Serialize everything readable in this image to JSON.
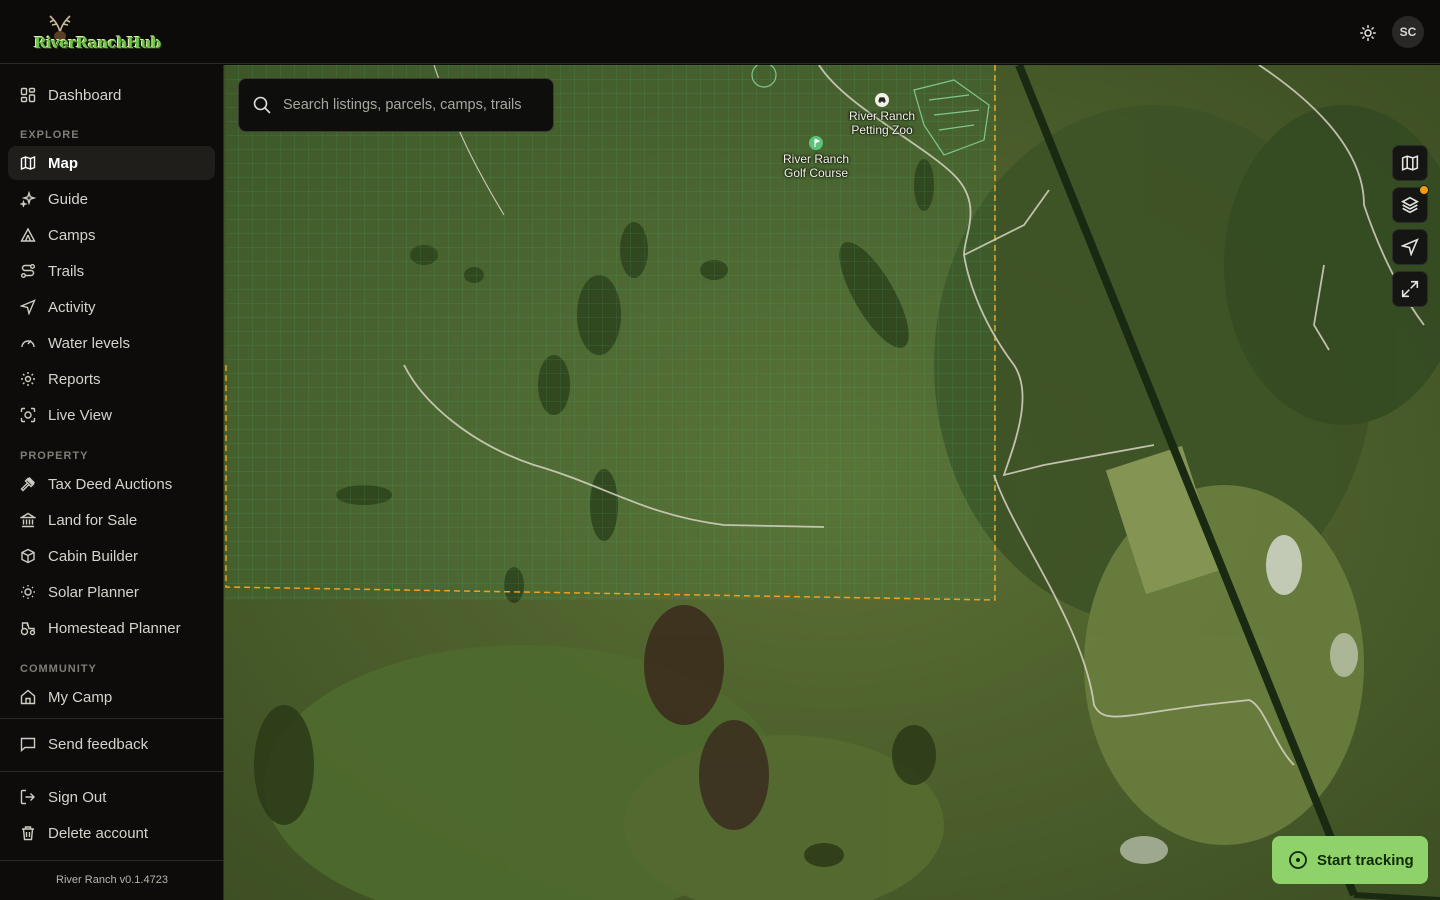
{
  "app": {
    "logo_text": "RiverRanchHub",
    "user_initials": "SC",
    "version": "River Ranch v0.1.4723"
  },
  "search": {
    "placeholder": "Search listings, parcels, camps, trails"
  },
  "sidebar": {
    "dashboard": "Dashboard",
    "explore_label": "EXPLORE",
    "explore": [
      {
        "label": "Map",
        "icon": "map-icon",
        "active": true
      },
      {
        "label": "Guide",
        "icon": "sparkles-icon"
      },
      {
        "label": "Camps",
        "icon": "tent-icon"
      },
      {
        "label": "Trails",
        "icon": "route-icon"
      },
      {
        "label": "Activity",
        "icon": "navigation-icon"
      },
      {
        "label": "Water levels",
        "icon": "gauge-icon"
      },
      {
        "label": "Reports",
        "icon": "reports-icon"
      },
      {
        "label": "Live View",
        "icon": "camera-icon"
      }
    ],
    "property_label": "PROPERTY",
    "property": [
      {
        "label": "Tax Deed Auctions",
        "icon": "gavel-icon"
      },
      {
        "label": "Land for Sale",
        "icon": "landmark-icon"
      },
      {
        "label": "Cabin Builder",
        "icon": "box-icon"
      },
      {
        "label": "Solar Planner",
        "icon": "sun-icon"
      },
      {
        "label": "Homestead Planner",
        "icon": "tractor-icon"
      }
    ],
    "community_label": "COMMUNITY",
    "community": [
      {
        "label": "My Camp",
        "icon": "home-icon"
      }
    ],
    "feedback": "Send feedback",
    "sign_out": "Sign Out",
    "delete_account": "Delete account"
  },
  "map": {
    "poi": [
      {
        "label": "River Ranch Petting Zoo",
        "lines": [
          "River Ranch",
          "Petting Zoo"
        ]
      },
      {
        "label": "River Ranch Golf Course",
        "lines": [
          "River Ranch",
          "Golf Course"
        ]
      }
    ],
    "controls": [
      "map-style-icon",
      "layers-icon",
      "locate-icon",
      "fullscreen-icon"
    ],
    "track_button": "Start tracking"
  },
  "colors": {
    "accent_green": "#8fd26a",
    "parcel_boundary": "#f0a020",
    "notification_dot": "#f59e0b"
  }
}
